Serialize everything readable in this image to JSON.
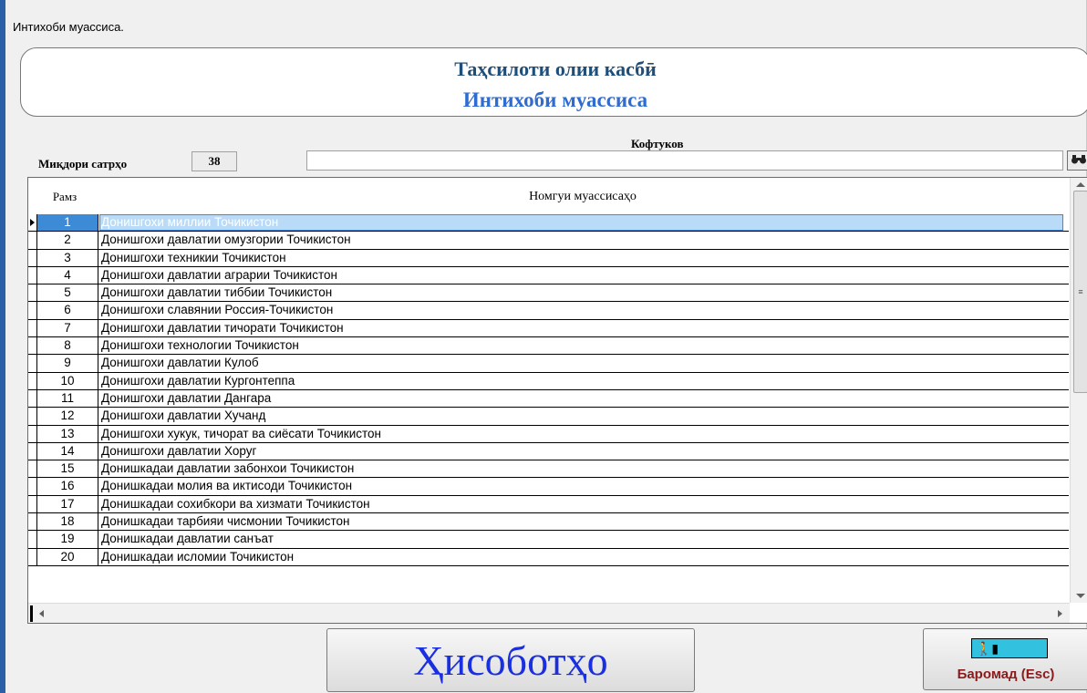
{
  "window": {
    "title": "Интихоби муассиса."
  },
  "header": {
    "title": "Таҳсилоти олии касбӣ",
    "subtitle": "Интихоби муассиса"
  },
  "toolbar": {
    "row_count_label": "Миқдори сатрҳо",
    "row_count_value": "38",
    "search_label": "Кофтуков",
    "search_value": "",
    "search_icon": "binoculars-icon"
  },
  "grid": {
    "columns": [
      "Рамз",
      "Номгуи муассисаҳо"
    ],
    "rows": [
      {
        "code": "1",
        "name": "Донишгохи миллии Точикистон",
        "selected": true
      },
      {
        "code": "2",
        "name": "Донишгохи давлатии омузгории Точикистон"
      },
      {
        "code": "3",
        "name": "Донишгохи техникии Точикистон"
      },
      {
        "code": "4",
        "name": "Донишгохи давлатии аграрии Точикистон"
      },
      {
        "code": "5",
        "name": "Донишгохи давлатии тиббии Точикистон"
      },
      {
        "code": "6",
        "name": "Донишгохи славянии Россия-Точикистон"
      },
      {
        "code": "7",
        "name": "Донишгохи давлатии тичорати Точикистон"
      },
      {
        "code": "8",
        "name": "Донишгохи технологии Точикистон"
      },
      {
        "code": "9",
        "name": "Донишгохи давлатии Кулоб"
      },
      {
        "code": "10",
        "name": "Донишгохи давлатии Кургонтеппа"
      },
      {
        "code": "11",
        "name": "Донишгохи давлатии Дангара"
      },
      {
        "code": "12",
        "name": "Донишгохи давлатии  Хучанд"
      },
      {
        "code": "13",
        "name": "Донишгохи хукук, тичорат ва сиёсати Точикистон"
      },
      {
        "code": "14",
        "name": "Донишгохи давлатии Хоруг"
      },
      {
        "code": "15",
        "name": "Донишкадаи давлатии забонхои Точикистон"
      },
      {
        "code": "16",
        "name": "Донишкадаи молия ва иктисоди Точикистон"
      },
      {
        "code": "17",
        "name": "Донишкадаи сохибкори ва хизмати Точикистон"
      },
      {
        "code": "18",
        "name": "Донишкадаи тарбияи чисмонии Точикистон"
      },
      {
        "code": "19",
        "name": "Донишкадаи давлатии  санъат"
      },
      {
        "code": "20",
        "name": "Донишкадаи исломии Точикистон"
      }
    ]
  },
  "buttons": {
    "reports": "Ҳисоботҳо",
    "exit": "Баромад (Esc)",
    "exit_icon": "exit-door-icon"
  }
}
